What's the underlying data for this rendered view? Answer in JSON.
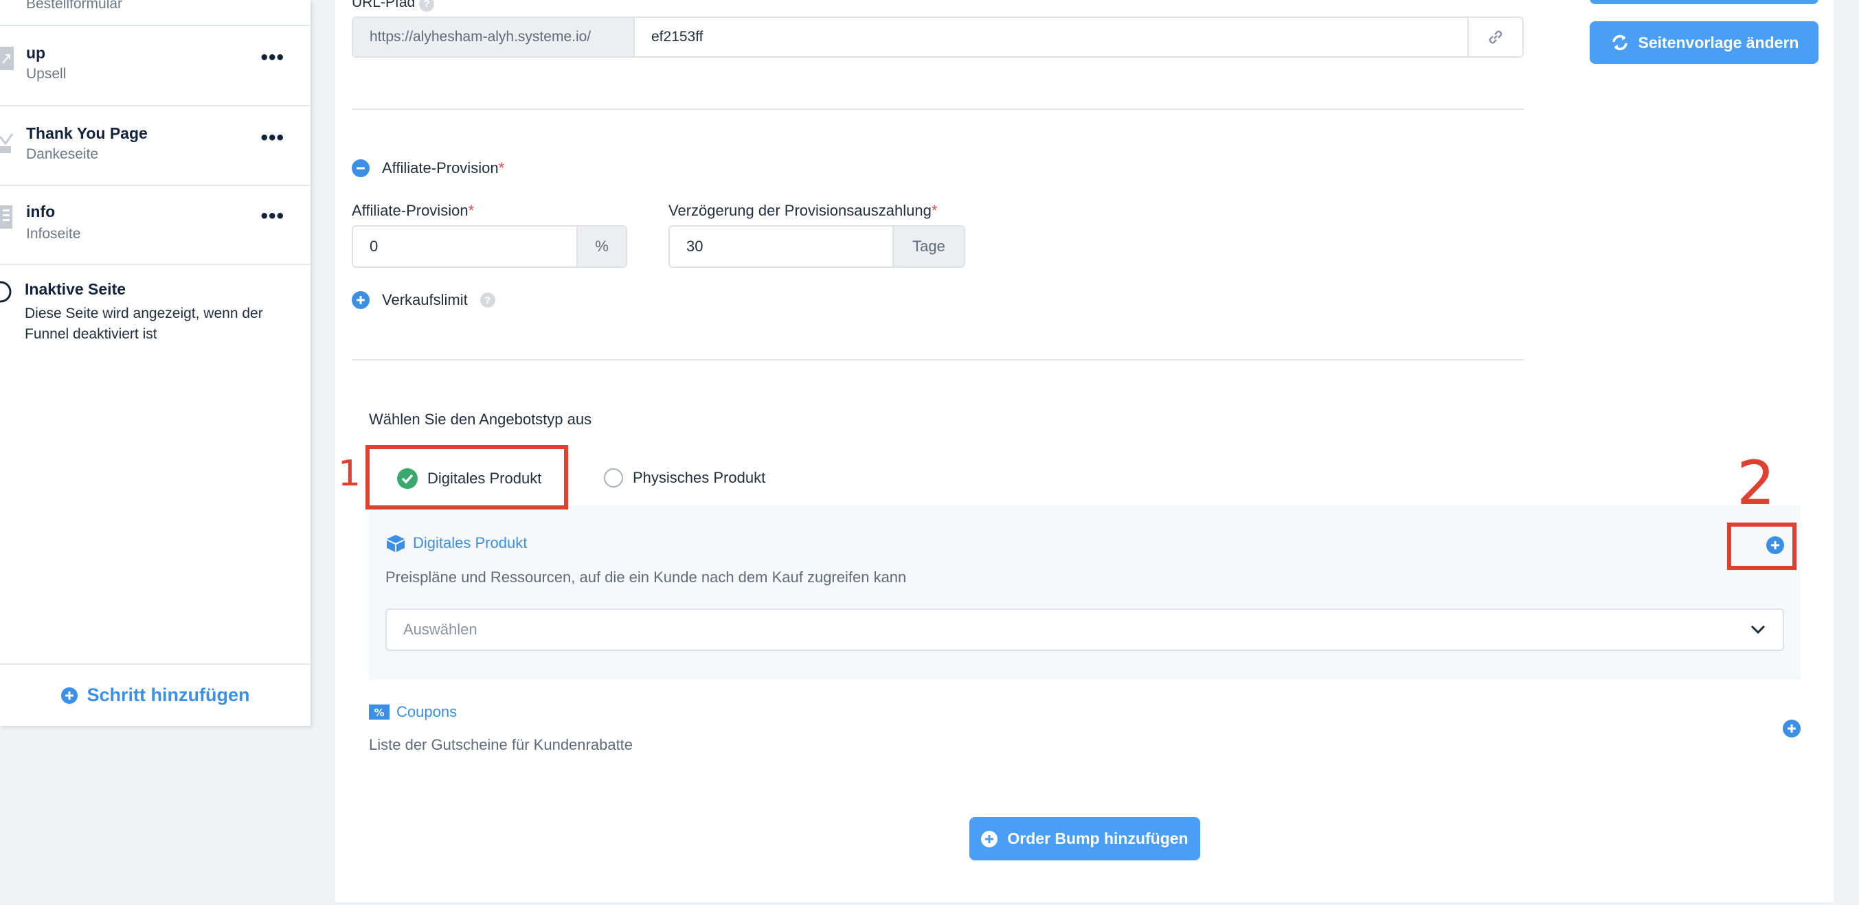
{
  "sidebar": {
    "partial_top_label": "Bestellformular",
    "items": [
      {
        "title": "up",
        "subtitle": "Upsell"
      },
      {
        "title": "Thank You Page",
        "subtitle": "Dankeseite"
      },
      {
        "title": "info",
        "subtitle": "Infoseite"
      }
    ],
    "more_label": "•••",
    "inactive": {
      "title": "Inaktive Seite",
      "description": "Diese Seite wird angezeigt, wenn der Funnel deaktiviert ist"
    },
    "add_step_label": "Schritt hinzufügen"
  },
  "header": {
    "url_label": "URL-Pfad",
    "url_prefix": "https://alyhesham-alyh.systeme.io/",
    "url_value": "ef2153ff",
    "template_button": "Seitenvorlage ändern"
  },
  "affiliate": {
    "section_toggle": "Affiliate-Provision",
    "commission_label": "Affiliate-Provision",
    "commission_value": "0",
    "commission_unit": "%",
    "delay_label": "Verzögerung der Provisionsauszahlung",
    "delay_value": "30",
    "delay_unit": "Tage",
    "required_mark": "*"
  },
  "sales_limit": {
    "label": "Verkaufslimit",
    "help": "?"
  },
  "offer": {
    "label": "Wählen Sie den Angebotstyp aus",
    "options": [
      {
        "label": "Digitales Produkt",
        "selected": true
      },
      {
        "label": "Physisches Produkt",
        "selected": false
      }
    ]
  },
  "digital_product": {
    "title": "Digitales Produkt",
    "description": "Preispläne und Ressourcen, auf die ein Kunde nach dem Kauf zugreifen kann",
    "select_placeholder": "Auswählen"
  },
  "coupons": {
    "title": "Coupons",
    "description": "Liste der Gutscheine für Kundenrabatte"
  },
  "order_bump_button": "Order Bump hinzufügen",
  "annotations": {
    "one": "1",
    "two": "2"
  },
  "colors": {
    "accent": "#4a9ff5",
    "success": "#3aa76d",
    "annotation": "#e0402f"
  }
}
